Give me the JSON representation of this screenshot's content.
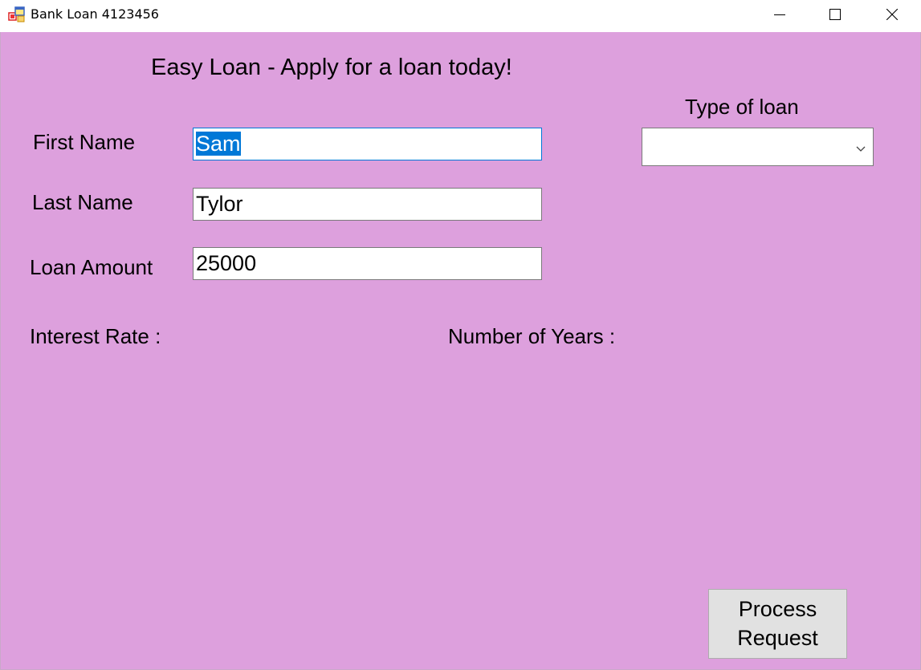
{
  "window": {
    "title": "Bank Loan 4123456"
  },
  "form": {
    "heading": "Easy Loan - Apply for a loan today!",
    "first_name_label": "First Name",
    "first_name_value": "Sam",
    "last_name_label": "Last Name",
    "last_name_value": "Tylor",
    "loan_amount_label": "Loan Amount",
    "loan_amount_value": "25000",
    "type_of_loan_label": "Type of loan",
    "type_of_loan_value": "",
    "interest_rate_label": "Interest Rate :",
    "number_of_years_label": "Number of Years :",
    "process_button_line1": "Process",
    "process_button_line2": "Request"
  },
  "icons": {
    "app": "app-form-icon",
    "minimize": "minimize-icon",
    "maximize": "maximize-icon",
    "close": "close-icon",
    "dropdown": "chevron-down-icon"
  },
  "colors": {
    "form_background": "#dda0dd",
    "selection_highlight": "#0078d7",
    "button_face": "#e1e1e1"
  }
}
